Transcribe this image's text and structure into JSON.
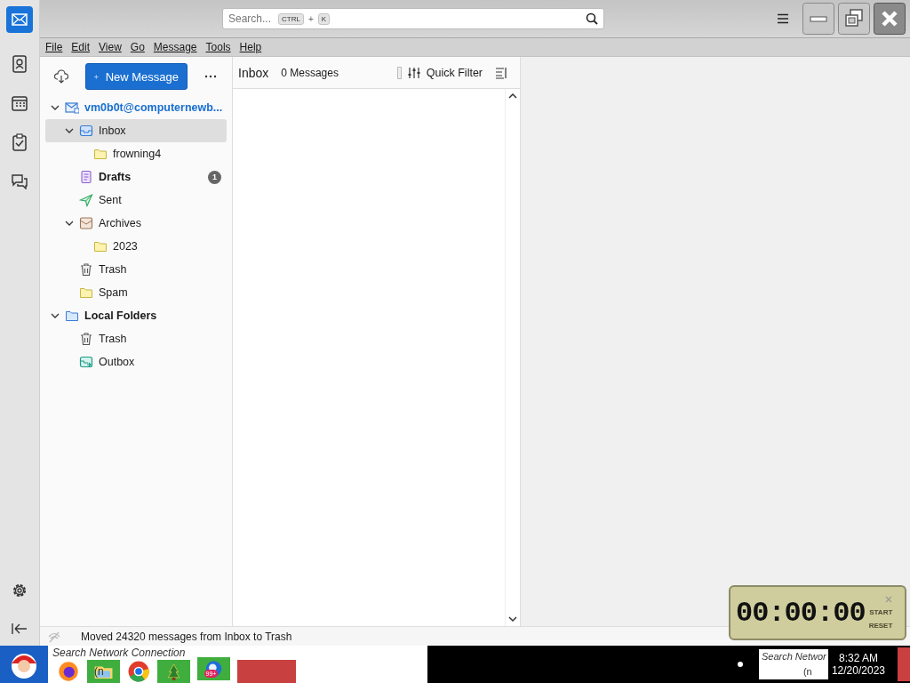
{
  "search": {
    "placeholder": "Search...",
    "keys": [
      "CTRL",
      "+",
      "K"
    ]
  },
  "menu": [
    {
      "label": "File"
    },
    {
      "label": "Edit"
    },
    {
      "label": "View"
    },
    {
      "label": "Go"
    },
    {
      "label": "Message"
    },
    {
      "label": "Tools"
    },
    {
      "label": "Help"
    }
  ],
  "folder_pane": {
    "new_message": "New Message",
    "tree": [
      {
        "name": "vm0b0t@computernewb...",
        "kind": "account",
        "expanded": true,
        "selected": false,
        "children": [
          {
            "name": "Inbox",
            "kind": "inbox",
            "expanded": true,
            "selected": true,
            "children": [
              {
                "name": "frowning4",
                "kind": "folder",
                "selected": false
              }
            ]
          },
          {
            "name": "Drafts",
            "kind": "drafts",
            "selected": false,
            "unread": true,
            "badge": "1"
          },
          {
            "name": "Sent",
            "kind": "sent",
            "selected": false
          },
          {
            "name": "Archives",
            "kind": "archive",
            "expanded": true,
            "selected": false,
            "children": [
              {
                "name": "2023",
                "kind": "folder",
                "selected": false
              }
            ]
          },
          {
            "name": "Trash",
            "kind": "trash",
            "selected": false
          },
          {
            "name": "Spam",
            "kind": "folder",
            "selected": false
          }
        ]
      },
      {
        "name": "Local Folders",
        "kind": "local",
        "expanded": true,
        "selected": false,
        "children": [
          {
            "name": "Trash",
            "kind": "trash",
            "selected": false
          },
          {
            "name": "Outbox",
            "kind": "outbox",
            "selected": false
          }
        ]
      }
    ]
  },
  "message_list": {
    "folder": "Inbox",
    "count": "0 Messages",
    "quick_filter": "Quick Filter"
  },
  "status_bar": {
    "text": "Moved 24320 messages from Inbox to Trash"
  },
  "timer": {
    "display": "00:00:00",
    "buttons": [
      "START",
      "RESET"
    ]
  },
  "taskbar": {
    "ghost_text": "Search Network Connection",
    "ghost_text_2": "(n",
    "mail_badge": "99+",
    "tray_ghost_text": "Search Networ",
    "tray_ghost_text_2": "(n",
    "time": "8:32 AM",
    "date": "12/20/2023"
  }
}
